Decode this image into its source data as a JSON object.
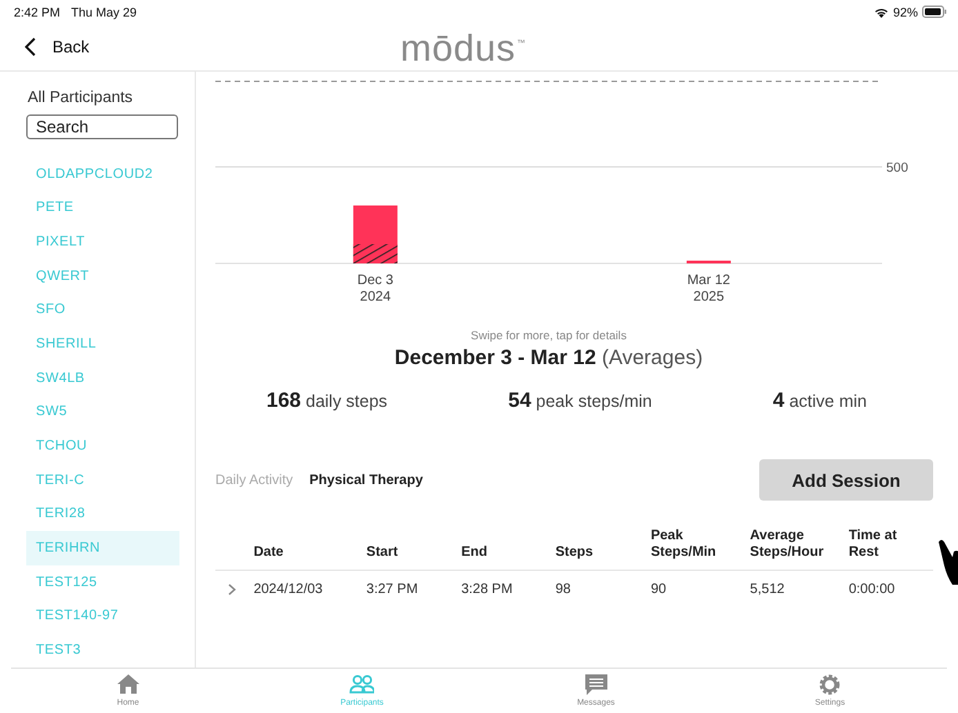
{
  "status_bar": {
    "time": "2:42 PM",
    "date": "Thu May 29",
    "battery": "92%"
  },
  "nav": {
    "back": "Back",
    "logo": "mōdus",
    "trademark": "™"
  },
  "sidebar": {
    "title": "All Participants",
    "search": {
      "placeholder": "Search"
    },
    "items": [
      {
        "label": "OLDAPPCLOUD2",
        "selected": false
      },
      {
        "label": "PETE",
        "selected": false
      },
      {
        "label": "PIXELT",
        "selected": false
      },
      {
        "label": "QWERT",
        "selected": false
      },
      {
        "label": "SFO",
        "selected": false
      },
      {
        "label": "SHERILL",
        "selected": false
      },
      {
        "label": "SW4LB",
        "selected": false
      },
      {
        "label": "SW5",
        "selected": false
      },
      {
        "label": "TCHOU",
        "selected": false
      },
      {
        "label": "TERI-C",
        "selected": false
      },
      {
        "label": "TERI28",
        "selected": false
      },
      {
        "label": "TERIHRN",
        "selected": true
      },
      {
        "label": "TEST125",
        "selected": false
      },
      {
        "label": "TEST140-97",
        "selected": false
      },
      {
        "label": "TEST3",
        "selected": false
      }
    ]
  },
  "chart": {
    "tick_label": "500",
    "x_labels": [
      [
        "Dec 3",
        "2024"
      ],
      [
        "Mar 12",
        "2025"
      ]
    ],
    "hint": "Swipe for more, tap for details",
    "range": "**December 3 - Mar 12** (Averages)",
    "stats": [
      {
        "value": "168",
        "label": "daily steps"
      },
      {
        "value": "54",
        "label": "peak steps/min"
      },
      {
        "value": "4",
        "label": "active min"
      }
    ]
  },
  "tabs": [
    {
      "label": "Daily Activity",
      "selected": false
    },
    {
      "label": "Physical Therapy",
      "selected": true
    }
  ],
  "add_button": "Add Session",
  "table": {
    "columns": [
      "Date",
      "Start",
      "End",
      "Steps",
      "Peak Steps/Min",
      "Average Steps/Hour",
      "Time at Rest"
    ],
    "rows": [
      {
        "cells": [
          "2024/12/03",
          "3:27 PM",
          "3:28 PM",
          "98",
          "90",
          "5,512",
          "0:00:00"
        ]
      }
    ]
  },
  "tab_bar": [
    {
      "label": "Home",
      "kind": "home",
      "selected": false
    },
    {
      "label": "Participants",
      "kind": "people",
      "selected": true
    },
    {
      "label": "Messages",
      "kind": "message",
      "selected": false
    },
    {
      "label": "Settings",
      "kind": "gear",
      "selected": false
    }
  ]
}
